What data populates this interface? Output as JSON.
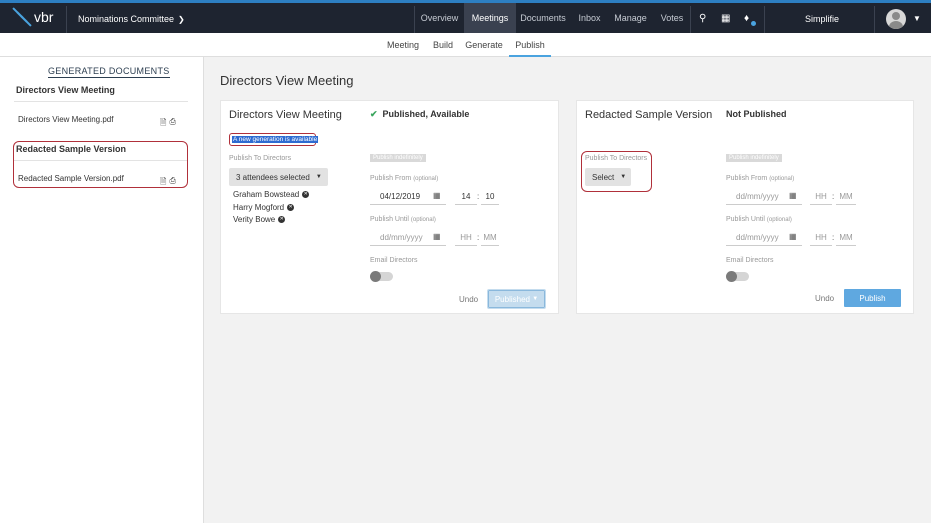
{
  "app": {
    "logo_text": "vbr",
    "committee": "Nominations Committee",
    "user": "Simplifie"
  },
  "nav": [
    {
      "label": "Overview"
    },
    {
      "label": "Meetings"
    },
    {
      "label": "Documents"
    },
    {
      "label": "Inbox"
    },
    {
      "label": "Manage"
    },
    {
      "label": "Votes"
    }
  ],
  "subnav": [
    {
      "label": "Meeting"
    },
    {
      "label": "Build"
    },
    {
      "label": "Generate"
    },
    {
      "label": "Publish"
    }
  ],
  "sidebar": {
    "title": "GENERATED DOCUMENTS",
    "groups": [
      {
        "title": "Directors View Meeting",
        "file": "Directors View Meeting.pdf"
      },
      {
        "title": "Redacted Sample Version",
        "file": "Redacted Sample Version.pdf"
      }
    ]
  },
  "main": {
    "title": "Directors View Meeting",
    "cards": [
      {
        "title": "Directors View Meeting",
        "status": "Published, Available",
        "banner": "A new generation is available",
        "publish_to_label": "Publish To Directors",
        "publish_to_value": "3 attendees selected",
        "attendees": [
          "Graham Bowstead",
          "Harry Mogford",
          "Verity Bowe"
        ],
        "chip": "Publish indefinitely",
        "from_label": "Publish From",
        "optional": "(optional)",
        "from_date": "04/12/2019",
        "from_hh": "14",
        "from_mm": "10",
        "until_label": "Publish Until",
        "until_date": "dd/mm/yyyy",
        "until_hh": "HH",
        "until_mm": "MM",
        "email_label": "Email Directors",
        "undo": "Undo",
        "action": "Published"
      },
      {
        "title": "Redacted Sample Version",
        "status": "Not Published",
        "publish_to_label": "Publish To Directors",
        "publish_to_value": "Select",
        "chip": "Publish indefinitely",
        "from_label": "Publish From",
        "optional": "(optional)",
        "from_date": "dd/mm/yyyy",
        "from_hh": "HH",
        "from_mm": "MM",
        "until_label": "Publish Until",
        "until_date": "dd/mm/yyyy",
        "until_hh": "HH",
        "until_mm": "MM",
        "email_label": "Email Directors",
        "undo": "Undo",
        "action": "Publish"
      }
    ]
  },
  "colors": {
    "topbar": "#1e2430",
    "accent": "#4aa3df",
    "publish_button": "#5fa8e0",
    "highlight": "#b0303a"
  }
}
